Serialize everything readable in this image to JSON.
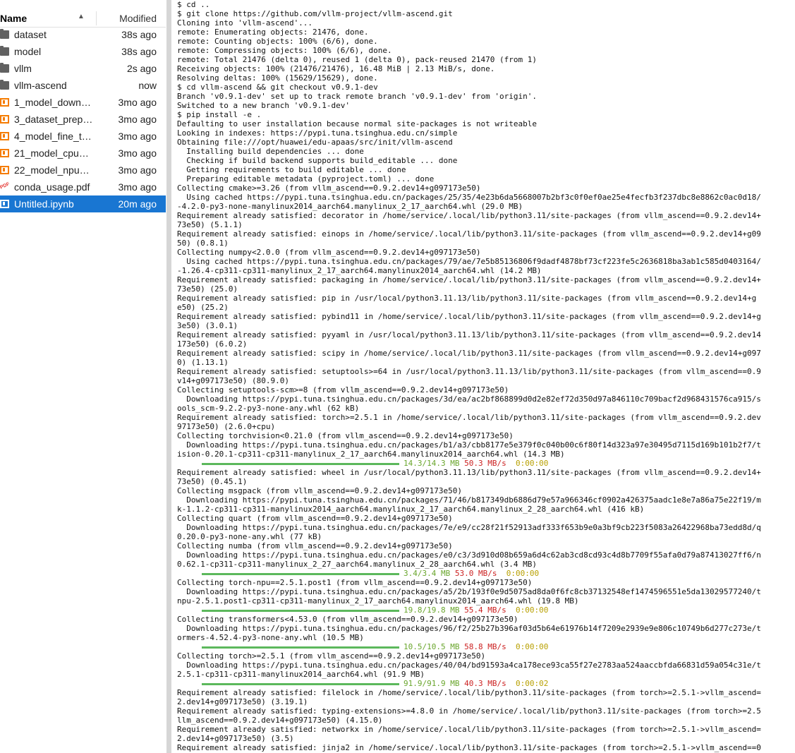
{
  "file_browser": {
    "columns": {
      "name": "Name",
      "modified": "Modified"
    },
    "items": [
      {
        "name": "dataset",
        "modified": "38s ago",
        "icon": "folder-icon"
      },
      {
        "name": "model",
        "modified": "38s ago",
        "icon": "folder-icon"
      },
      {
        "name": "vllm",
        "modified": "2s ago",
        "icon": "folder-icon"
      },
      {
        "name": "vllm-ascend",
        "modified": "now",
        "icon": "folder-icon"
      },
      {
        "name": "1_model_download.ipynb",
        "modified": "3mo ago",
        "icon": "notebook-icon"
      },
      {
        "name": "3_dataset_preparation.ipynb",
        "modified": "3mo ago",
        "icon": "notebook-icon"
      },
      {
        "name": "4_model_fine_tuning.ipynb",
        "modified": "3mo ago",
        "icon": "notebook-icon"
      },
      {
        "name": "21_model_cpu_inference.ipynb",
        "modified": "3mo ago",
        "icon": "notebook-icon"
      },
      {
        "name": "22_model_npu_inference.ipynb",
        "modified": "3mo ago",
        "icon": "notebook-icon"
      },
      {
        "name": "conda_usage.pdf",
        "modified": "3mo ago",
        "icon": "pdf-icon"
      },
      {
        "name": "Untitled.ipynb",
        "modified": "20m ago",
        "icon": "notebook-icon",
        "selected": true
      }
    ]
  },
  "terminal": {
    "lines": [
      "$ cd ..",
      "$ git clone https://github.com/vllm-project/vllm-ascend.git",
      "Cloning into 'vllm-ascend'...",
      "remote: Enumerating objects: 21476, done.",
      "remote: Counting objects: 100% (6/6), done.",
      "remote: Compressing objects: 100% (6/6), done.",
      "remote: Total 21476 (delta 0), reused 1 (delta 0), pack-reused 21470 (from 1)",
      "Receiving objects: 100% (21476/21476), 16.48 MiB | 2.13 MiB/s, done.",
      "Resolving deltas: 100% (15629/15629), done.",
      "$ cd vllm-ascend && git checkout v0.9.1-dev",
      "Branch 'v0.9.1-dev' set up to track remote branch 'v0.9.1-dev' from 'origin'.",
      "Switched to a new branch 'v0.9.1-dev'",
      "$ pip install -e .",
      "Defaulting to user installation because normal site-packages is not writeable",
      "Looking in indexes: https://pypi.tuna.tsinghua.edu.cn/simple",
      "Obtaining file:///opt/huawei/edu-apaas/src/init/vllm-ascend",
      "  Installing build dependencies ... done",
      "  Checking if build backend supports build_editable ... done",
      "  Getting requirements to build editable ... done",
      "  Preparing editable metadata (pyproject.toml) ... done",
      "Collecting cmake>=3.26 (from vllm_ascend==0.9.2.dev14+g097173e50)",
      "  Using cached https://pypi.tuna.tsinghua.edu.cn/packages/25/35/4e23b6da5668007b2bf3c0f0ef0ae25e4fecfb3f237dbc8e8862c0ac0d18/",
      "-4.2.0-py3-none-manylinux2014_aarch64.manylinux_2_17_aarch64.whl (29.0 MB)",
      "Requirement already satisfied: decorator in /home/service/.local/lib/python3.11/site-packages (from vllm_ascend==0.9.2.dev14+",
      "73e50) (5.1.1)",
      "Requirement already satisfied: einops in /home/service/.local/lib/python3.11/site-packages (from vllm_ascend==0.9.2.dev14+g09",
      "50) (0.8.1)",
      "Collecting numpy<2.0.0 (from vllm_ascend==0.9.2.dev14+g097173e50)",
      "  Using cached https://pypi.tuna.tsinghua.edu.cn/packages/79/ae/7e5b85136806f9dadf4878bf73cf223fe5c2636818ba3ab1c585d0403164/",
      "-1.26.4-cp311-cp311-manylinux_2_17_aarch64.manylinux2014_aarch64.whl (14.2 MB)",
      "Requirement already satisfied: packaging in /home/service/.local/lib/python3.11/site-packages (from vllm_ascend==0.9.2.dev14+",
      "73e50) (25.0)",
      "Requirement already satisfied: pip in /usr/local/python3.11.13/lib/python3.11/site-packages (from vllm_ascend==0.9.2.dev14+g",
      "e50) (25.2)",
      "Requirement already satisfied: pybind11 in /home/service/.local/lib/python3.11/site-packages (from vllm_ascend==0.9.2.dev14+g",
      "3e50) (3.0.1)",
      "Requirement already satisfied: pyyaml in /usr/local/python3.11.13/lib/python3.11/site-packages (from vllm_ascend==0.9.2.dev14",
      "173e50) (6.0.2)",
      "Requirement already satisfied: scipy in /home/service/.local/lib/python3.11/site-packages (from vllm_ascend==0.9.2.dev14+g097",
      "0) (1.13.1)",
      "Requirement already satisfied: setuptools>=64 in /usr/local/python3.11.13/lib/python3.11/site-packages (from vllm_ascend==0.9",
      "v14+g097173e50) (80.9.0)",
      "Collecting setuptools-scm>=8 (from vllm_ascend==0.9.2.dev14+g097173e50)",
      "  Downloading https://pypi.tuna.tsinghua.edu.cn/packages/3d/ea/ac2bf868899d0d2e82ef72d350d97a846110c709bacf2d968431576ca915/s",
      "ools_scm-9.2.2-py3-none-any.whl (62 kB)",
      "Requirement already satisfied: torch>=2.5.1 in /home/service/.local/lib/python3.11/site-packages (from vllm_ascend==0.9.2.dev",
      "97173e50) (2.6.0+cpu)",
      "Collecting torchvision<0.21.0 (from vllm_ascend==0.9.2.dev14+g097173e50)",
      "  Downloading https://pypi.tuna.tsinghua.edu.cn/packages/b1/a3/cbb8177e5e379f0c040b00c6f80f14d323a97e30495d7115d169b101b2f7/t",
      "ision-0.20.1-cp311-cp311-manylinux_2_17_aarch64.manylinux2014_aarch64.whl (14.3 MB)",
      {
        "progress": {
          "size": "14.3/14.3 MB",
          "speed": "50.3 MB/s",
          "eta": "0:00:00",
          "fraction": 1.0
        }
      },
      "Requirement already satisfied: wheel in /usr/local/python3.11.13/lib/python3.11/site-packages (from vllm_ascend==0.9.2.dev14+",
      "73e50) (0.45.1)",
      "Collecting msgpack (from vllm_ascend==0.9.2.dev14+g097173e50)",
      "  Downloading https://pypi.tuna.tsinghua.edu.cn/packages/71/46/b817349db6886d79e57a966346cf0902a426375aadc1e8e7a86a75e22f19/m",
      "k-1.1.2-cp311-cp311-manylinux2014_aarch64.manylinux_2_17_aarch64.manylinux_2_28_aarch64.whl (416 kB)",
      "Collecting quart (from vllm_ascend==0.9.2.dev14+g097173e50)",
      "  Downloading https://pypi.tuna.tsinghua.edu.cn/packages/7e/e9/cc28f21f52913adf333f653b9e0a3bf9cb223f5083a26422968ba73edd8d/q",
      "0.20.0-py3-none-any.whl (77 kB)",
      "Collecting numba (from vllm_ascend==0.9.2.dev14+g097173e50)",
      "  Downloading https://pypi.tuna.tsinghua.edu.cn/packages/e0/c3/3d910d08b659a6d4c62ab3cd8cd93c4d8b7709f55afa0d79a87413027ff6/n",
      "0.62.1-cp311-cp311-manylinux_2_27_aarch64.manylinux_2_28_aarch64.whl (3.4 MB)",
      {
        "progress": {
          "size": "3.4/3.4 MB",
          "speed": "53.0 MB/s",
          "eta": "0:00:00",
          "fraction": 1.0
        }
      },
      "Collecting torch-npu==2.5.1.post1 (from vllm_ascend==0.9.2.dev14+g097173e50)",
      "  Downloading https://pypi.tuna.tsinghua.edu.cn/packages/a5/2b/193f0e9d5075ad8da0f6fc8cb37132548ef1474596551e5da13029577240/t",
      "npu-2.5.1.post1-cp311-cp311-manylinux_2_17_aarch64.manylinux2014_aarch64.whl (19.8 MB)",
      {
        "progress": {
          "size": "19.8/19.8 MB",
          "speed": "55.4 MB/s",
          "eta": "0:00:00",
          "fraction": 1.0
        }
      },
      "Collecting transformers<4.53.0 (from vllm_ascend==0.9.2.dev14+g097173e50)",
      "  Downloading https://pypi.tuna.tsinghua.edu.cn/packages/96/f2/25b27b396af03d5b64e61976b14f7209e2939e9e806c10749b6d277c273e/t",
      "ormers-4.52.4-py3-none-any.whl (10.5 MB)",
      {
        "progress": {
          "size": "10.5/10.5 MB",
          "speed": "58.8 MB/s",
          "eta": "0:00:00",
          "fraction": 1.0
        }
      },
      "Collecting torch>=2.5.1 (from vllm_ascend==0.9.2.dev14+g097173e50)",
      "  Downloading https://pypi.tuna.tsinghua.edu.cn/packages/40/04/bd91593a4ca178ece93ca55f27e2783aa524aaccbfda66831d59a054c31e/t",
      "2.5.1-cp311-cp311-manylinux2014_aarch64.whl (91.9 MB)",
      {
        "progress": {
          "size": "91.9/91.9 MB",
          "speed": "40.3 MB/s",
          "eta": "0:00:02",
          "fraction": 1.0
        }
      },
      "Requirement already satisfied: filelock in /home/service/.local/lib/python3.11/site-packages (from torch>=2.5.1->vllm_ascend=",
      "2.dev14+g097173e50) (3.19.1)",
      "Requirement already satisfied: typing-extensions>=4.8.0 in /home/service/.local/lib/python3.11/site-packages (from torch>=2.5",
      "llm_ascend==0.9.2.dev14+g097173e50) (4.15.0)",
      "Requirement already satisfied: networkx in /home/service/.local/lib/python3.11/site-packages (from torch>=2.5.1->vllm_ascend=",
      "2.dev14+g097173e50) (3.5)",
      "Requirement already satisfied: jinja2 in /home/service/.local/lib/python3.11/site-packages (from torch>=2.5.1->vllm_ascend==0"
    ]
  }
}
